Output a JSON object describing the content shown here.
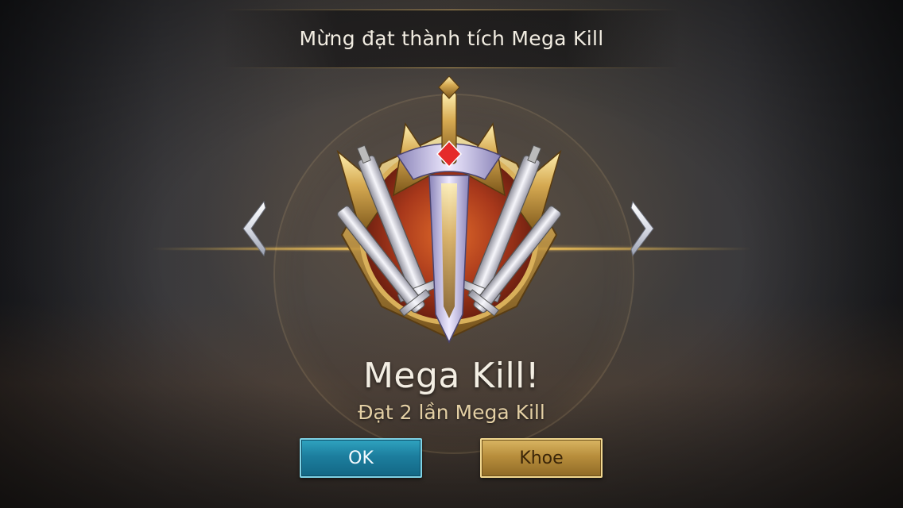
{
  "header": {
    "title": "Mừng đạt thành tích Mega Kill"
  },
  "achievement": {
    "name": "Mega Kill!",
    "description": "Đạt 2 lần Mega Kill",
    "emblem_icon": "crossed-swords-badge-icon"
  },
  "navigation": {
    "prev_icon": "chevron-left-icon",
    "next_icon": "chevron-right-icon"
  },
  "buttons": {
    "ok_label": "OK",
    "share_label": "Khoe"
  },
  "colors": {
    "ok_button": "#1c7e9e",
    "share_button": "#b88e3c",
    "accent_gold": "#c9a660"
  }
}
